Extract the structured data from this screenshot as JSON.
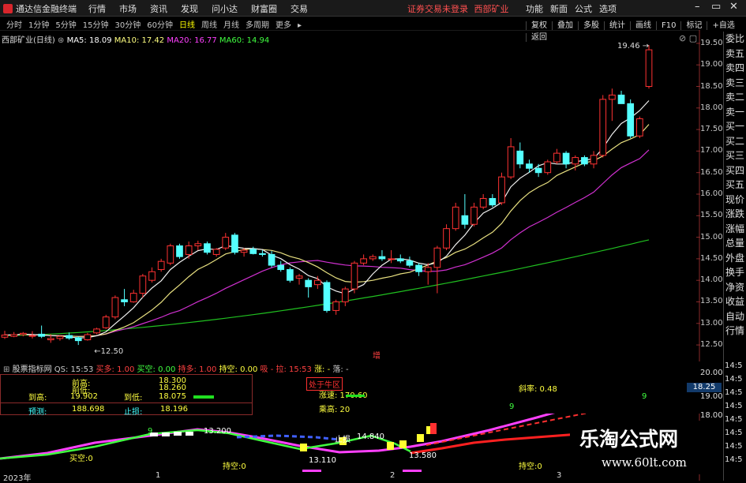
{
  "titlebar": {
    "app_name": "通达信金融终端",
    "menus": [
      "行情",
      "市场",
      "资讯",
      "发现",
      "问小达",
      "财富圈",
      "交易"
    ],
    "warning": "证券交易未登录",
    "stock": "西部矿业",
    "right_menus": [
      "功能",
      "新面",
      "公式",
      "选项"
    ],
    "right_icons": [
      "minimize-icon",
      "restore-icon",
      "close-icon"
    ]
  },
  "periods": [
    "分时",
    "1分钟",
    "5分钟",
    "15分钟",
    "30分钟",
    "60分钟",
    "日线",
    "周线",
    "月线",
    "多周期",
    "更多"
  ],
  "active_period": "日线",
  "right_tools": [
    "复权",
    "叠加",
    "多股",
    "统计",
    "画线",
    "F10",
    "标记",
    "+自选",
    "返回"
  ],
  "ma": {
    "title": "西部矿业(日线)",
    "items": [
      {
        "label": "MA5: 18.09",
        "color": "#ffffff"
      },
      {
        "label": "MA10: 17.42",
        "color": "#ffff80"
      },
      {
        "label": "MA20: 16.77",
        "color": "#ff40ff"
      },
      {
        "label": "MA60: 14.94",
        "color": "#40ff40"
      }
    ]
  },
  "right_panel": [
    "委比",
    "卖五",
    "卖四",
    "卖三",
    "卖二",
    "卖一",
    "买一",
    "买二",
    "买三",
    "买四",
    "买五",
    "现价",
    "涨跌",
    "涨幅",
    "总量",
    "外盘",
    "换手",
    "净资",
    "收益",
    "自动",
    "行情"
  ],
  "right_panel2": [
    "14:5",
    "14:5",
    "14:5",
    "14:5",
    "14:5",
    "14:5",
    "14:5",
    "14:5"
  ],
  "price_axis": [
    "19.50",
    "19.00",
    "18.50",
    "18.00",
    "17.50",
    "17.00",
    "16.50",
    "16.00",
    "15.50",
    "15.00",
    "14.50",
    "14.00",
    "13.50",
    "13.00",
    "12.50"
  ],
  "chart_labels": {
    "high": "19.46",
    "low": "12.50",
    "marker": "增"
  },
  "chart_data": {
    "type": "candlestick",
    "ylim": [
      12.3,
      19.7
    ],
    "candles": [
      [
        12.68,
        12.83,
        12.64,
        12.73
      ],
      [
        12.7,
        12.8,
        12.68,
        12.74
      ],
      [
        12.74,
        12.8,
        12.7,
        12.77
      ],
      [
        12.7,
        12.82,
        12.65,
        12.72
      ],
      [
        12.75,
        12.95,
        12.66,
        12.7
      ],
      [
        12.62,
        12.75,
        12.55,
        12.65
      ],
      [
        12.65,
        12.72,
        12.6,
        12.7
      ],
      [
        12.72,
        12.79,
        12.62,
        12.66
      ],
      [
        12.67,
        12.7,
        12.5,
        12.6
      ],
      [
        12.62,
        12.78,
        12.6,
        12.74
      ],
      [
        12.78,
        12.9,
        12.75,
        12.87
      ],
      [
        12.9,
        13.2,
        12.87,
        13.15
      ],
      [
        13.15,
        13.65,
        13.1,
        13.6
      ],
      [
        13.55,
        13.8,
        13.4,
        13.5
      ],
      [
        13.5,
        13.78,
        13.48,
        13.7
      ],
      [
        13.7,
        14.15,
        13.6,
        14.1
      ],
      [
        14.0,
        14.3,
        13.95,
        14.2
      ],
      [
        14.25,
        14.5,
        14.2,
        14.44
      ],
      [
        14.4,
        14.85,
        14.35,
        14.8
      ],
      [
        14.8,
        14.85,
        14.5,
        14.55
      ],
      [
        14.6,
        14.9,
        14.5,
        14.8
      ],
      [
        14.8,
        14.92,
        14.7,
        14.85
      ],
      [
        14.85,
        14.9,
        14.6,
        14.65
      ],
      [
        14.6,
        14.75,
        14.55,
        14.72
      ],
      [
        14.75,
        15.1,
        14.7,
        15.0
      ],
      [
        15.05,
        15.1,
        14.6,
        14.65
      ],
      [
        14.65,
        14.75,
        14.55,
        14.7
      ],
      [
        14.72,
        14.78,
        14.6,
        14.62
      ],
      [
        14.62,
        14.7,
        14.55,
        14.6
      ],
      [
        14.6,
        14.68,
        14.3,
        14.35
      ],
      [
        14.35,
        14.45,
        14.2,
        14.25
      ],
      [
        14.25,
        14.3,
        13.95,
        14.0
      ],
      [
        14.05,
        14.15,
        13.9,
        14.1
      ],
      [
        14.0,
        14.05,
        13.6,
        13.85
      ],
      [
        13.9,
        14.1,
        13.8,
        14.0
      ],
      [
        13.95,
        14.0,
        13.25,
        13.3
      ],
      [
        13.3,
        13.55,
        13.2,
        13.5
      ],
      [
        13.5,
        13.85,
        13.4,
        13.8
      ],
      [
        13.8,
        14.45,
        13.7,
        14.4
      ],
      [
        14.4,
        14.6,
        14.35,
        14.5
      ],
      [
        14.5,
        14.6,
        14.45,
        14.55
      ],
      [
        14.55,
        14.7,
        14.45,
        14.5
      ],
      [
        14.5,
        14.7,
        14.4,
        14.5
      ],
      [
        14.5,
        14.6,
        14.4,
        14.45
      ],
      [
        14.45,
        14.55,
        14.3,
        14.35
      ],
      [
        14.35,
        14.4,
        14.1,
        14.2
      ],
      [
        14.2,
        14.4,
        13.9,
        14.3
      ],
      [
        14.3,
        14.8,
        13.7,
        14.75
      ],
      [
        14.75,
        15.3,
        14.7,
        15.2
      ],
      [
        15.2,
        15.8,
        15.15,
        15.7
      ],
      [
        15.5,
        16.0,
        15.2,
        15.3
      ],
      [
        15.3,
        15.8,
        15.25,
        15.7
      ],
      [
        15.7,
        16.0,
        15.65,
        15.9
      ],
      [
        15.9,
        16.0,
        15.7,
        15.75
      ],
      [
        15.8,
        16.5,
        15.75,
        16.4
      ],
      [
        16.4,
        17.3,
        16.35,
        17.1
      ],
      [
        17.0,
        17.2,
        16.6,
        16.7
      ],
      [
        16.7,
        16.8,
        16.5,
        16.6
      ],
      [
        16.6,
        16.7,
        16.4,
        16.5
      ],
      [
        16.5,
        16.8,
        16.45,
        16.75
      ],
      [
        16.75,
        17.05,
        16.7,
        16.95
      ],
      [
        16.95,
        17.0,
        16.6,
        16.7
      ],
      [
        16.7,
        16.9,
        16.55,
        16.85
      ],
      [
        16.85,
        16.9,
        16.65,
        16.7
      ],
      [
        16.7,
        17.0,
        16.6,
        16.9
      ],
      [
        16.9,
        18.3,
        16.85,
        18.2
      ],
      [
        18.2,
        18.45,
        17.7,
        18.3
      ],
      [
        18.3,
        18.4,
        18.1,
        18.1
      ],
      [
        18.1,
        18.2,
        17.3,
        17.35
      ],
      [
        17.35,
        17.8,
        17.3,
        17.75
      ],
      [
        18.5,
        19.46,
        18.45,
        19.35
      ]
    ],
    "ma_series": [
      {
        "name": "MA5",
        "color": "#f0f0f0"
      },
      {
        "name": "MA10",
        "color": "#e8e080"
      },
      {
        "name": "MA20",
        "color": "#d030d0"
      },
      {
        "name": "MA60",
        "color": "#20c020"
      }
    ]
  },
  "indicator": {
    "name": "股票指标网",
    "items": [
      {
        "label": "QS: 15:53",
        "color": "#c8c8c8"
      },
      {
        "label": "买多: 1.00",
        "color": "#ff4040"
      },
      {
        "label": "买空: 0.00",
        "color": "#40ff40"
      },
      {
        "label": "持多: 1.00",
        "color": "#ff4040"
      },
      {
        "label": "持空: 0.00",
        "color": "#ffff40"
      },
      {
        "label": "吸",
        "color": "#ff4040"
      },
      {
        "label": "- 拉: 15:53",
        "color": "#ff4040"
      },
      {
        "label": "涨: -",
        "color": "#ffff40"
      },
      {
        "label": "落: -",
        "color": "#c8c8c8"
      }
    ],
    "table": {
      "r1": {
        "l1": "前高:",
        "v1": "18.300"
      },
      "r2": {
        "l1": "前低:",
        "v1": "18.260"
      },
      "r3": {
        "l0": "到高:",
        "v0": "19.902",
        "l1": "到低:",
        "v1": "18.075"
      },
      "r4": {
        "l0": "预测:",
        "v0": "188.698",
        "l1": "止损:",
        "v1": "18.196"
      }
    },
    "badge": "处于牛区",
    "speed": "涨速: 170.60",
    "rate": "乘高: 20",
    "slope": "斜率: 0.48",
    "axis": [
      "20.00",
      "19.00",
      "18.25",
      "18.00"
    ],
    "labels": [
      "13.110",
      "13.580",
      "14.840",
      "13.200",
      "9",
      "9",
      "9",
      "止损",
      "持空:0",
      "买空:0",
      "持空:0"
    ],
    "year": "2023年",
    "ticks": [
      "1",
      "2",
      "3"
    ]
  },
  "watermark": {
    "title": "乐淘公式网",
    "url": "www.60lt.com"
  }
}
